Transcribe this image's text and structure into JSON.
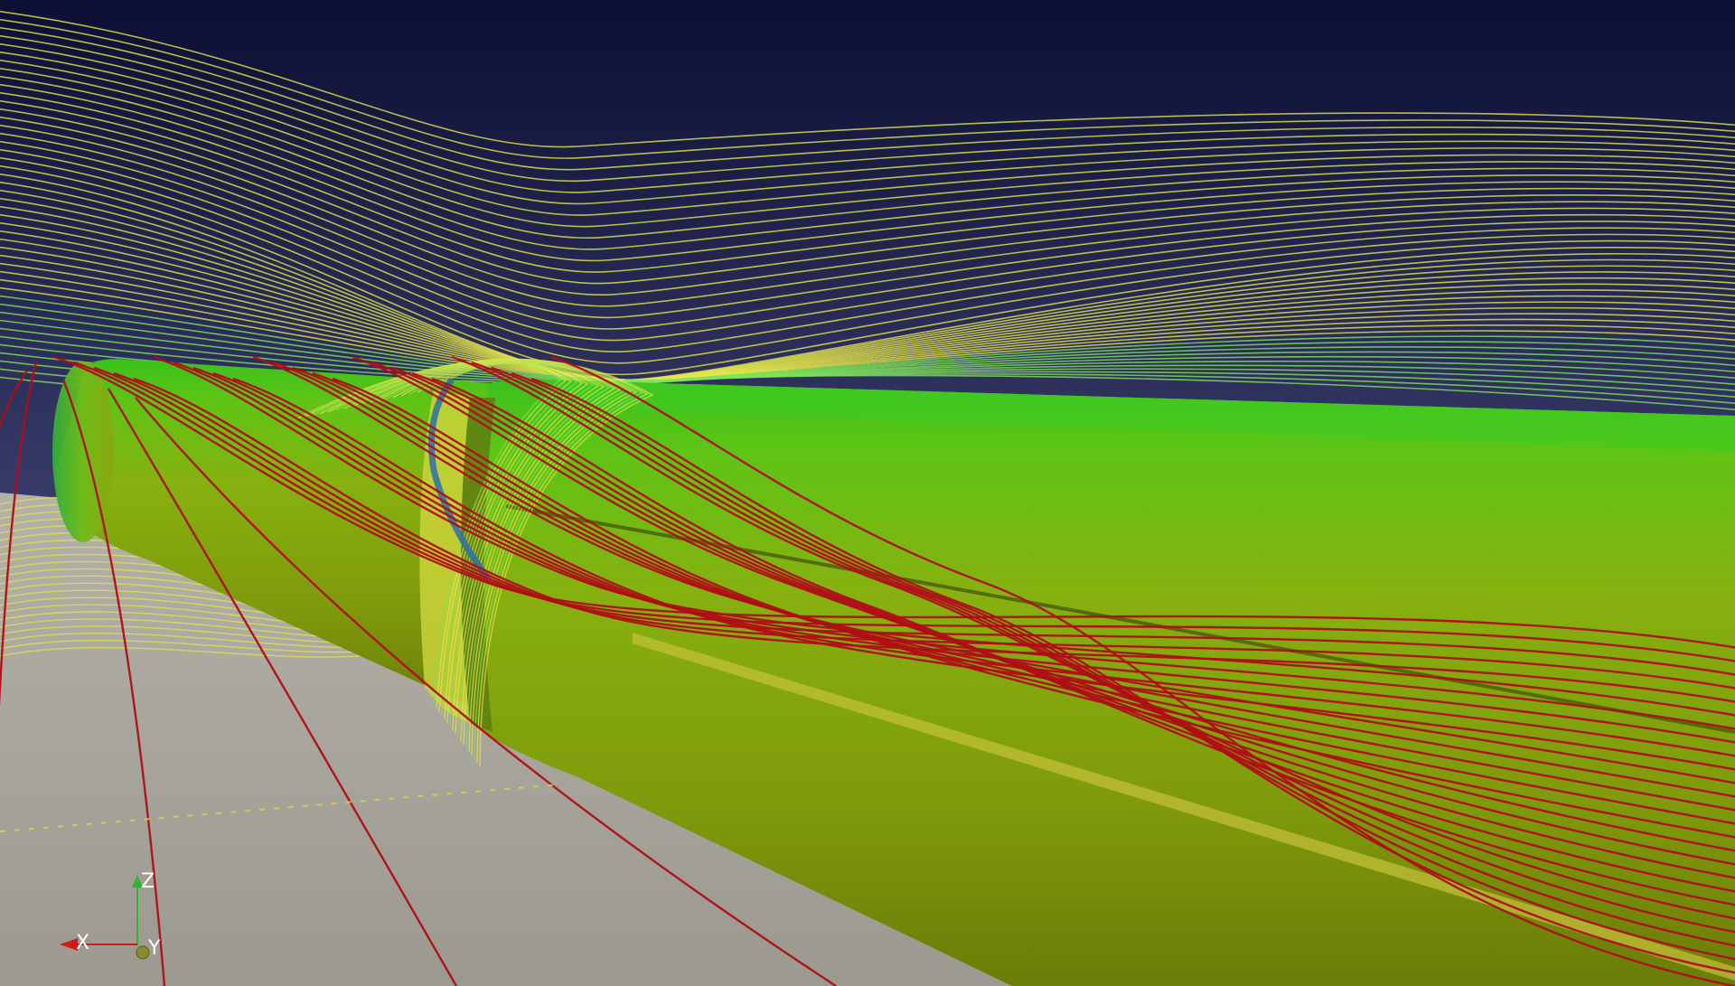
{
  "scene": {
    "colors": {
      "sky_top": "#0c0f33",
      "sky_bottom": "#6f739a",
      "floor": "#a8a69c",
      "tube_light": "#6ccf1e",
      "tube_mid": "#8aa612",
      "tube_dark": "#6d7e0a",
      "streamline_yellow": "#e4e64a",
      "streamline_green": "#7fe35a",
      "streamline_red": "#b00d16",
      "vortex_blue": "#2e6fa8"
    }
  },
  "axes_widget": {
    "z_label": "Z",
    "x_label": "X",
    "y_label": "Y",
    "colors": {
      "z": "#2fb52f",
      "x": "#d21a1a",
      "y": "#8a8a2a"
    }
  }
}
